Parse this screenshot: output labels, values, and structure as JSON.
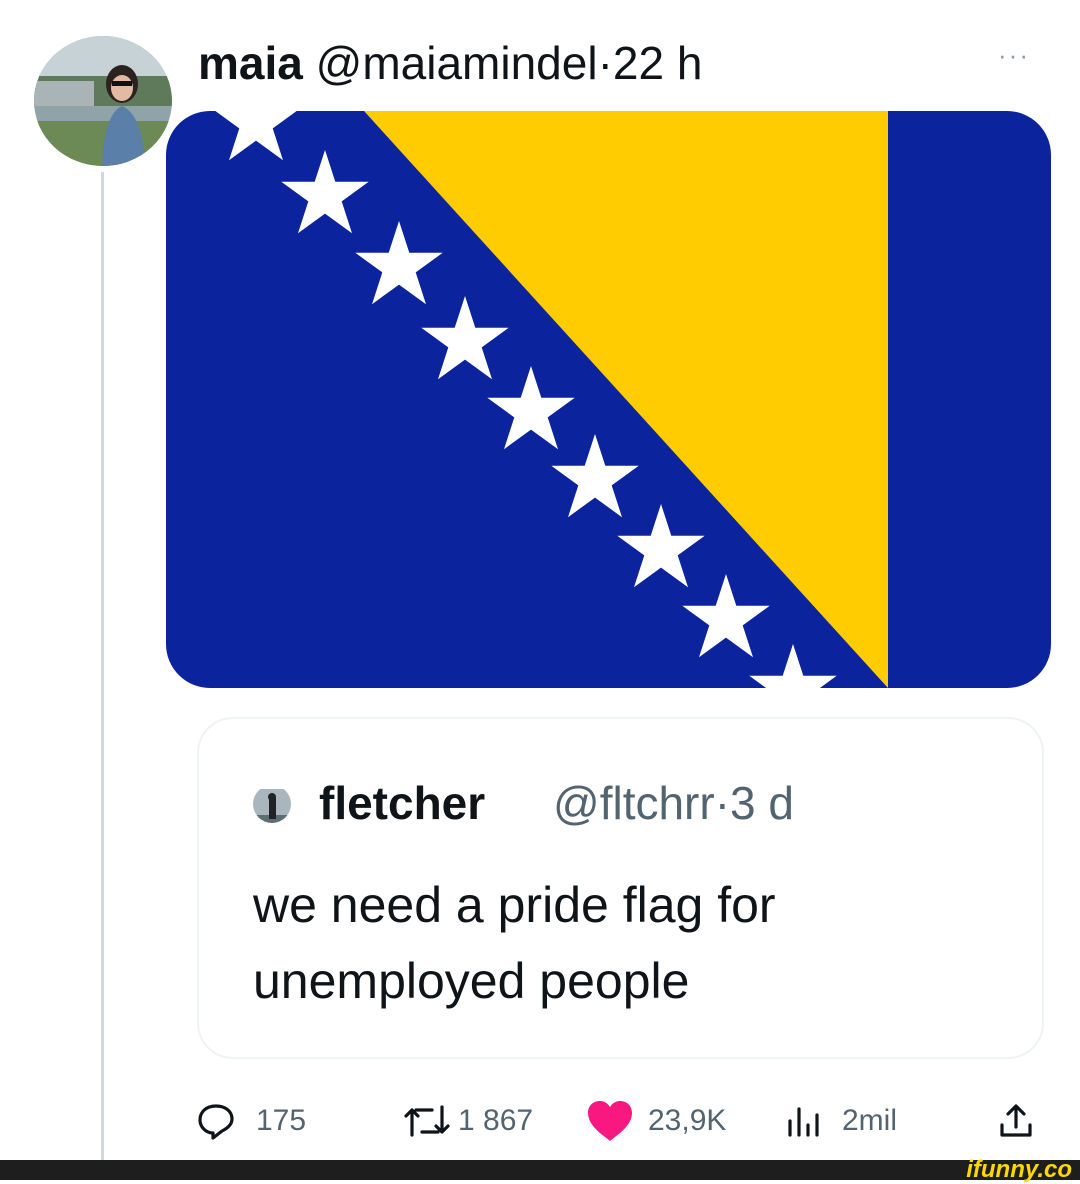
{
  "tweet": {
    "author_name": "maia",
    "author_handle": "@maiamindel",
    "separator": "·",
    "time": "22 h",
    "more": "···",
    "media": {
      "colors": {
        "blue": "#0b239d",
        "yellow": "#fecc00",
        "star": "#ffffff"
      }
    }
  },
  "quoted_tweet": {
    "author_name": "fletcher",
    "author_handle": "@fltchrr",
    "separator": "·",
    "time": "3 d",
    "text": "we need a pride flag for unemployed people"
  },
  "actions": {
    "replies": "175",
    "retweets": "1 867",
    "likes": "23,9K",
    "views": "2mil"
  },
  "watermark": "ifunny.co"
}
